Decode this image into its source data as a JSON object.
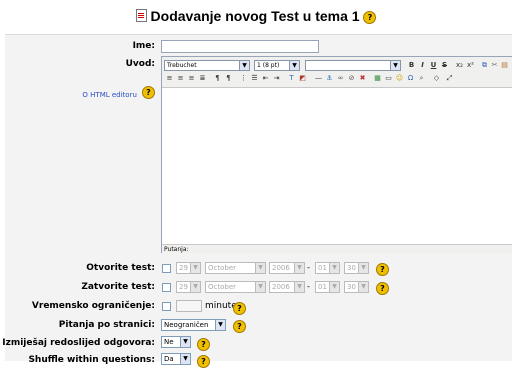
{
  "page": {
    "title": "Dodavanje novog Test u tema 1"
  },
  "form": {
    "name_label": "Ime:",
    "name_value": "",
    "intro_label": "Uvod:",
    "html_editor_link": "O HTML editoru",
    "editor": {
      "font_family": "Trebuchet",
      "font_size": "1 (8 pt)",
      "format": "",
      "status_path": "Putanja:"
    },
    "open_label": "Otvorite test:",
    "close_label": "Zatvorite test:",
    "open_date": {
      "day": "29",
      "month": "October",
      "year": "2006",
      "hour": "01",
      "minute": "30",
      "enabled": false
    },
    "close_date": {
      "day": "29",
      "month": "October",
      "year": "2006",
      "hour": "01",
      "minute": "30",
      "enabled": false
    },
    "dash": "-",
    "time_limit_label": "Vremensko ograničenje:",
    "time_limit_value": "",
    "time_limit_unit": "minute",
    "per_page_label": "Pitanja po stranici:",
    "per_page_value": "Neograničen",
    "shuffle_order_label": "Izmiješaj redoslijed odgovora:",
    "shuffle_order_value": "Ne",
    "shuffle_within_label": "Shuffle within questions:",
    "shuffle_within_value": "Da"
  },
  "toolbar": {
    "bold": "B",
    "italic": "I",
    "underline": "U",
    "strike": "S",
    "subscript": "x₂",
    "superscript": "x²",
    "help_glyph": "?"
  },
  "colors": {
    "panel_bg": "#f3f3f3",
    "help_icon": "#f0c000",
    "link": "#2b4fc9"
  }
}
